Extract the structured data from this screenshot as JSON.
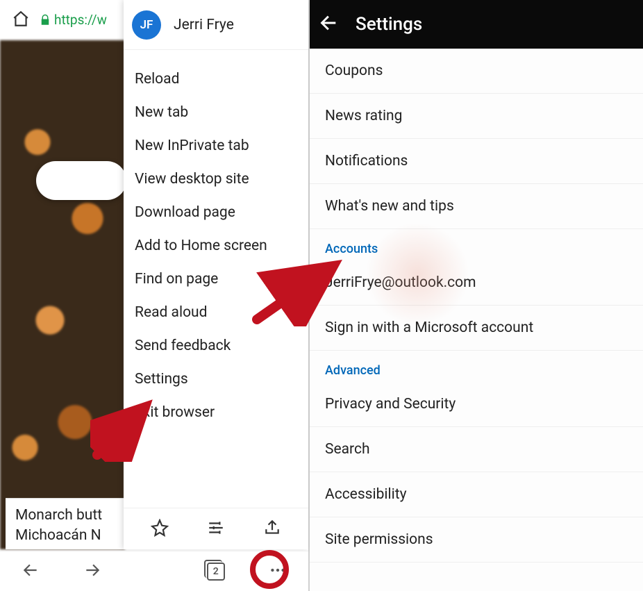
{
  "left": {
    "url_scheme": "https://w",
    "profile": {
      "initials": "JF",
      "name": "Jerri Frye"
    },
    "menu_items": [
      "Reload",
      "New tab",
      "New InPrivate tab",
      "View desktop site",
      "Download page",
      "Add to Home screen",
      "Find on page",
      "Read aloud",
      "Send feedback",
      "Settings",
      "Exit browser"
    ],
    "suggestion_line1": "Monarch butt",
    "suggestion_line2": "Michoacán  N",
    "tab_count": "2"
  },
  "right": {
    "header_title": "Settings",
    "items_top": [
      "Coupons",
      "News rating",
      "Notifications",
      "What's new and tips"
    ],
    "section_accounts": "Accounts",
    "account_email": "JerriFrye@outlook.com",
    "account_signin": "Sign in with a Microsoft account",
    "section_advanced": "Advanced",
    "items_advanced": [
      "Privacy and Security",
      "Search",
      "Accessibility",
      "Site permissions"
    ]
  }
}
